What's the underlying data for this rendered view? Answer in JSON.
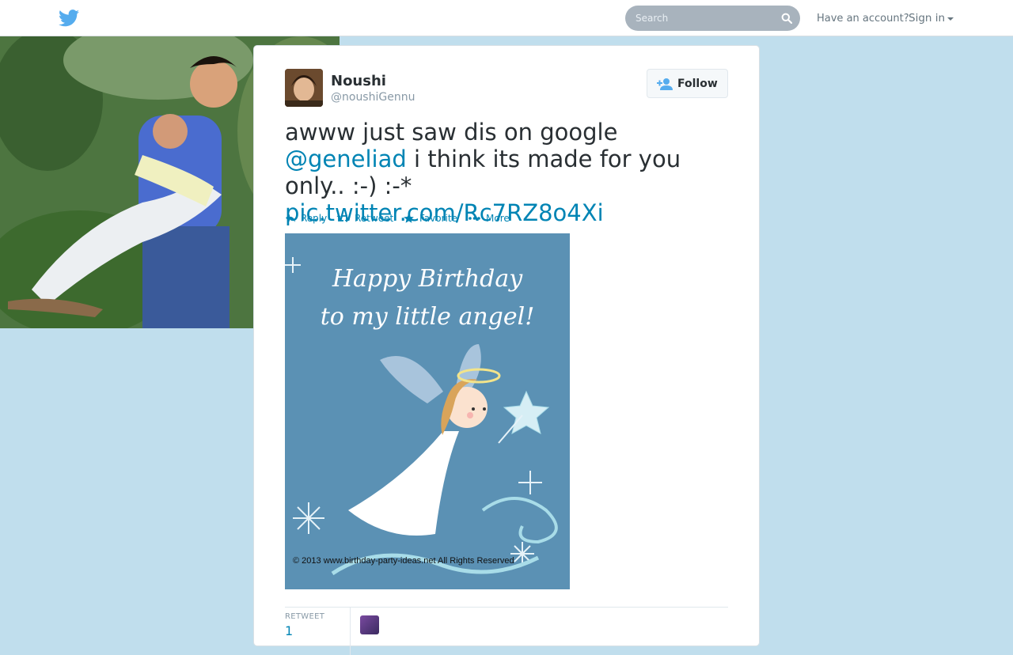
{
  "topbar": {
    "search_placeholder": "Search",
    "account_text": "Have an account?",
    "signin_label": "Sign in"
  },
  "tweet": {
    "name": "Noushi",
    "handle": "@noushiGennu",
    "follow_label": "Follow",
    "text_part1": "awww just saw dis on google ",
    "mention": "@geneliad",
    "text_part2": " i think its made for you only.. :-) :-* ",
    "pic_link": "pic.twitter.com/Rc7RZ8o4Xi",
    "actions": [
      "Reply",
      "Retweet",
      "Favorite",
      "More"
    ],
    "media": {
      "line1": "Happy Birthday",
      "line2": "to my little angel!",
      "copyright": "© 2013 www.birthday-party-ideas.net All Rights Reserved"
    },
    "stats": {
      "label": "RETWEET",
      "value": "1"
    }
  },
  "colors": {
    "background": "#c0deed",
    "link": "#0084b4",
    "twitter_blue": "#55acee"
  }
}
